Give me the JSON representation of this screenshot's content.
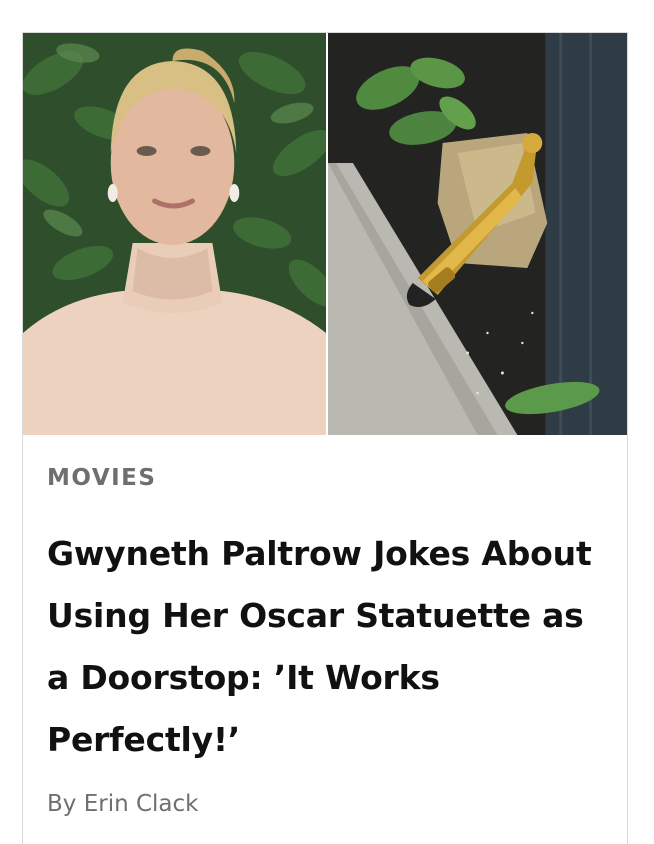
{
  "article": {
    "category": "MOVIES",
    "title": "Gwyneth Paltrow Jokes About Using Her Oscar Statuette as a Doorstop: ’It Works Perfectly!’",
    "byline_prefix": "By",
    "author": "Erin Clack"
  },
  "colors": {
    "category": "#6f6f6f",
    "title": "#111111",
    "byline": "#6f6f6f",
    "border": "#d9d9d9"
  }
}
